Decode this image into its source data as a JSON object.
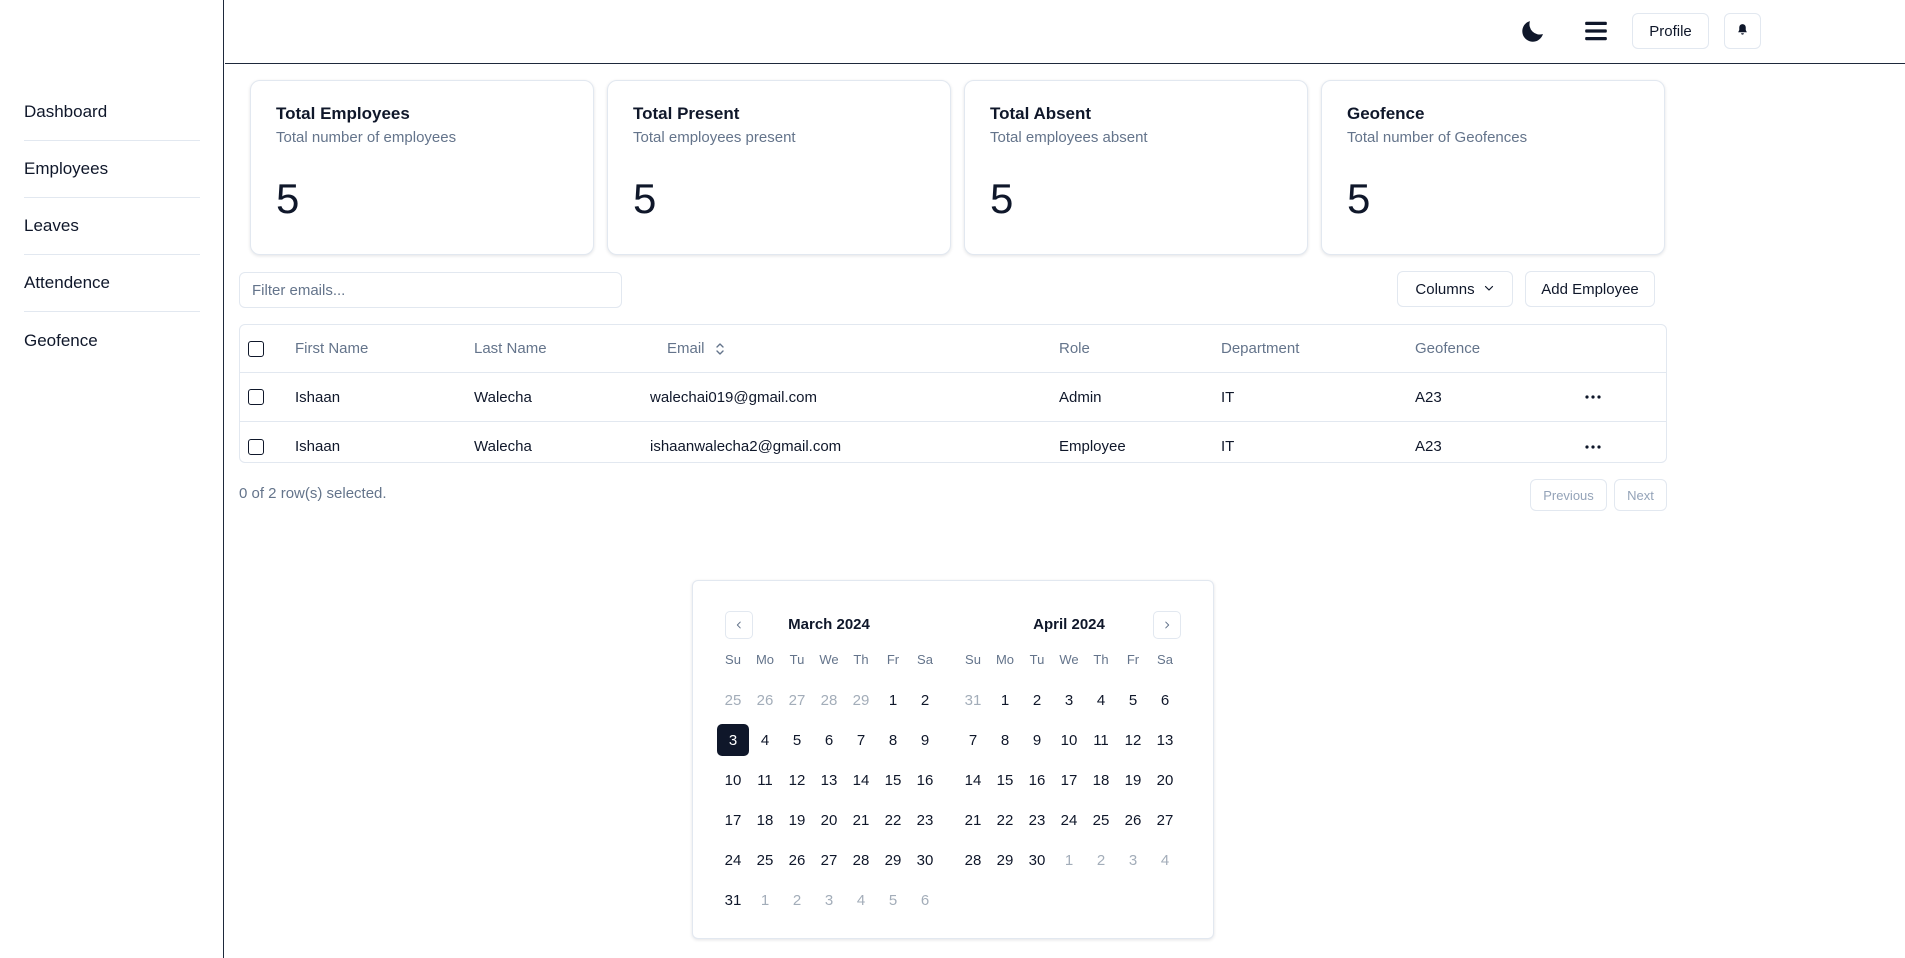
{
  "sidebar": {
    "items": [
      "Dashboard",
      "Employees",
      "Leaves",
      "Attendence",
      "Geofence"
    ]
  },
  "header": {
    "theme_icon": "moon-icon",
    "menu_icon": "hamburger-menu-icon",
    "profile_label": "Profile",
    "bell_icon": "bell-icon"
  },
  "stats": [
    {
      "title": "Total Employees",
      "subtitle": "Total number of employees",
      "value": "5"
    },
    {
      "title": "Total Present",
      "subtitle": "Total employees present",
      "value": "5"
    },
    {
      "title": "Total Absent",
      "subtitle": "Total employees absent",
      "value": "5"
    },
    {
      "title": "Geofence",
      "subtitle": "Total number of Geofences",
      "value": "5"
    }
  ],
  "toolbar": {
    "filter_placeholder": "Filter emails...",
    "columns_label": "Columns",
    "add_label": "Add Employee"
  },
  "table": {
    "headers": [
      "First Name",
      "Last Name",
      "Email",
      "Role",
      "Department",
      "Geofence"
    ],
    "rows": [
      {
        "first": "Ishaan",
        "last": "Walecha",
        "email": "walechai019@gmail.com",
        "role": "Admin",
        "dept": "IT",
        "geofence": "A23"
      },
      {
        "first": "Ishaan",
        "last": "Walecha",
        "email": "ishaanwalecha2@gmail.com",
        "role": "Employee",
        "dept": "IT",
        "geofence": "A23"
      }
    ]
  },
  "footer": {
    "selection": "0 of 2 row(s) selected.",
    "previous": "Previous",
    "next": "Next"
  },
  "calendar": {
    "weekdays": [
      "Su",
      "Mo",
      "Tu",
      "We",
      "Th",
      "Fr",
      "Sa"
    ],
    "selected_date": "3",
    "months": [
      {
        "title": "March 2024",
        "days": [
          {
            "d": "25",
            "out": true
          },
          {
            "d": "26",
            "out": true
          },
          {
            "d": "27",
            "out": true
          },
          {
            "d": "28",
            "out": true
          },
          {
            "d": "29",
            "out": true
          },
          {
            "d": "1"
          },
          {
            "d": "2"
          },
          {
            "d": "3",
            "sel": true
          },
          {
            "d": "4"
          },
          {
            "d": "5"
          },
          {
            "d": "6"
          },
          {
            "d": "7"
          },
          {
            "d": "8"
          },
          {
            "d": "9"
          },
          {
            "d": "10"
          },
          {
            "d": "11"
          },
          {
            "d": "12"
          },
          {
            "d": "13"
          },
          {
            "d": "14"
          },
          {
            "d": "15"
          },
          {
            "d": "16"
          },
          {
            "d": "17"
          },
          {
            "d": "18"
          },
          {
            "d": "19"
          },
          {
            "d": "20"
          },
          {
            "d": "21"
          },
          {
            "d": "22"
          },
          {
            "d": "23"
          },
          {
            "d": "24"
          },
          {
            "d": "25"
          },
          {
            "d": "26"
          },
          {
            "d": "27"
          },
          {
            "d": "28"
          },
          {
            "d": "29"
          },
          {
            "d": "30"
          },
          {
            "d": "31"
          },
          {
            "d": "1",
            "out": true
          },
          {
            "d": "2",
            "out": true
          },
          {
            "d": "3",
            "out": true
          },
          {
            "d": "4",
            "out": true
          },
          {
            "d": "5",
            "out": true
          },
          {
            "d": "6",
            "out": true
          }
        ]
      },
      {
        "title": "April 2024",
        "days": [
          {
            "d": "31",
            "out": true
          },
          {
            "d": "1"
          },
          {
            "d": "2"
          },
          {
            "d": "3"
          },
          {
            "d": "4"
          },
          {
            "d": "5"
          },
          {
            "d": "6"
          },
          {
            "d": "7"
          },
          {
            "d": "8"
          },
          {
            "d": "9"
          },
          {
            "d": "10"
          },
          {
            "d": "11"
          },
          {
            "d": "12"
          },
          {
            "d": "13"
          },
          {
            "d": "14"
          },
          {
            "d": "15"
          },
          {
            "d": "16"
          },
          {
            "d": "17"
          },
          {
            "d": "18"
          },
          {
            "d": "19"
          },
          {
            "d": "20"
          },
          {
            "d": "21"
          },
          {
            "d": "22"
          },
          {
            "d": "23"
          },
          {
            "d": "24"
          },
          {
            "d": "25"
          },
          {
            "d": "26"
          },
          {
            "d": "27"
          },
          {
            "d": "28"
          },
          {
            "d": "29"
          },
          {
            "d": "30"
          },
          {
            "d": "1",
            "out": true
          },
          {
            "d": "2",
            "out": true
          },
          {
            "d": "3",
            "out": true
          },
          {
            "d": "4",
            "out": true
          }
        ]
      }
    ]
  },
  "colors": {
    "text": "#0f172a",
    "muted": "#64748b",
    "border": "#e2e8f0",
    "selected_bg": "#0f172a"
  }
}
